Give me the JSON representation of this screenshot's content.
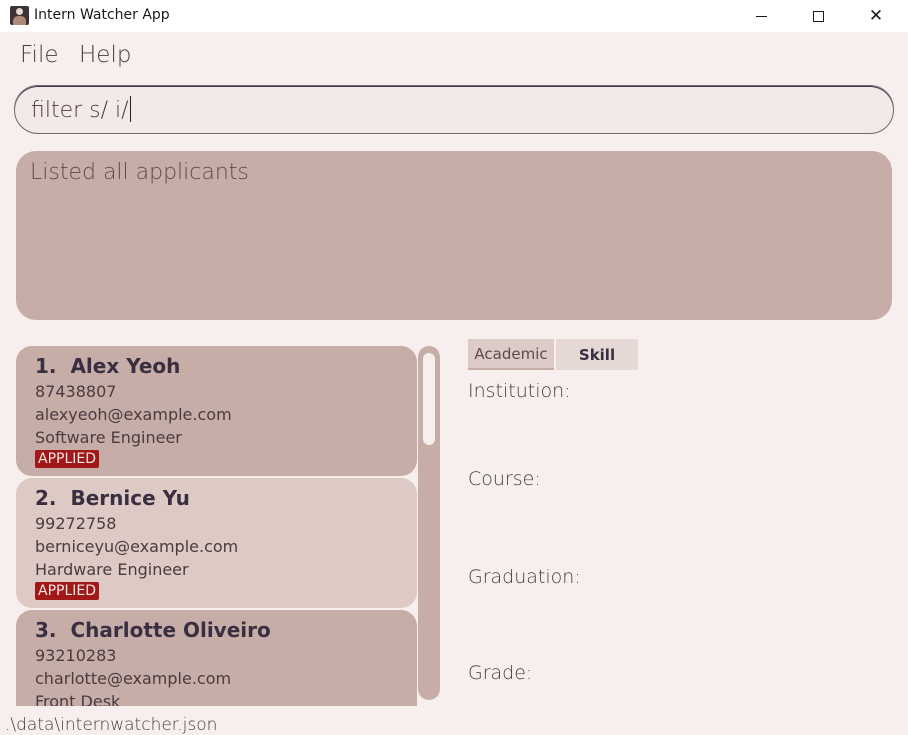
{
  "window": {
    "title": "Intern Watcher App",
    "minimize_icon": "minimize-icon",
    "maximize_icon": "maximize-icon",
    "close_glyph": "✕"
  },
  "menu": {
    "file_label": "File",
    "help_label": "Help"
  },
  "command": {
    "value": "filter s/ i/"
  },
  "result": {
    "message": "Listed all applicants"
  },
  "applicants": [
    {
      "index": "1.",
      "name": "Alex Yeoh",
      "phone": "87438807",
      "email": "alexyeoh@example.com",
      "role": "Software Engineer",
      "status": "APPLIED"
    },
    {
      "index": "2.",
      "name": "Bernice Yu",
      "phone": "99272758",
      "email": "berniceyu@example.com",
      "role": "Hardware Engineer",
      "status": "APPLIED"
    },
    {
      "index": "3.",
      "name": "Charlotte Oliveiro",
      "phone": "93210283",
      "email": "charlotte@example.com",
      "role": "Front Desk",
      "status": ""
    }
  ],
  "detail": {
    "tabs": {
      "academic": "Academic",
      "skill": "Skill"
    },
    "fields": {
      "institution": "Institution:",
      "course": "Course:",
      "graduation": "Graduation:",
      "grade": "Grade:"
    }
  },
  "status": {
    "file_path": ".\\data\\internwatcher.json"
  },
  "colors": {
    "card_primary": "#c6ada7",
    "card_alternate": "#ddcac5",
    "background": "#f6efed",
    "badge_applied": "#a01818"
  }
}
